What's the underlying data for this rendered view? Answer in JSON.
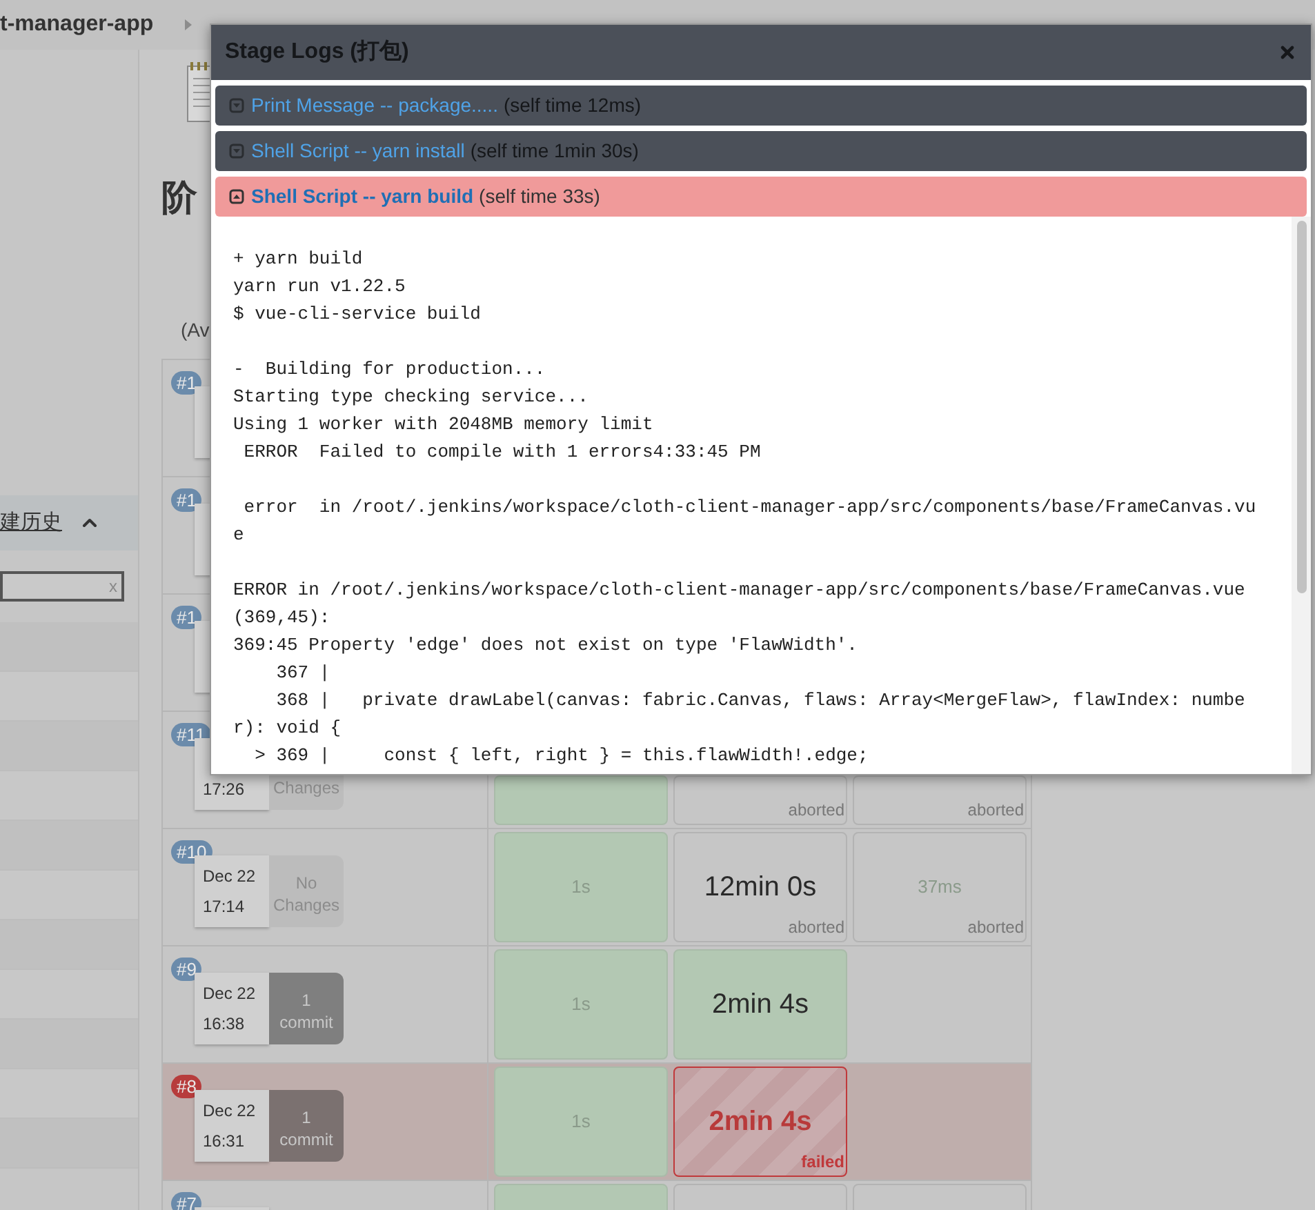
{
  "header": {
    "title": "t-manager-app"
  },
  "sidebar": {
    "section_title": "建历史",
    "expanded": true,
    "search": {
      "clear": "x"
    }
  },
  "page": {
    "heading": "阶",
    "column_hint": "(Av"
  },
  "builds": [
    {
      "number": "#1",
      "failed": false
    },
    {
      "number": "#1",
      "failed": false
    },
    {
      "number": "#1",
      "failed": false
    },
    {
      "number": "#11",
      "failed": false,
      "time": "17:26",
      "changes": {
        "text": "Changes",
        "has_changes": false
      },
      "stages": [
        {
          "kind": "success"
        },
        {
          "kind": "aborted",
          "label": "aborted"
        },
        {
          "kind": "aborted",
          "label": "aborted"
        }
      ]
    },
    {
      "number": "#10",
      "failed": false,
      "date": "Dec 22",
      "time": "17:14",
      "changes": {
        "text": "No Changes",
        "has_changes": false
      },
      "stages": [
        {
          "kind": "success",
          "duration": "1s",
          "emphasized": false
        },
        {
          "kind": "aborted",
          "duration": "12min 0s",
          "emphasized": true,
          "label": "aborted"
        },
        {
          "kind": "aborted",
          "duration": "37ms",
          "emphasized": false,
          "label": "aborted"
        }
      ]
    },
    {
      "number": "#9",
      "failed": false,
      "date": "Dec 22",
      "time": "16:38",
      "changes": {
        "text": "1 commit",
        "has_changes": true
      },
      "stages": [
        {
          "kind": "success",
          "duration": "1s",
          "emphasized": false
        },
        {
          "kind": "success",
          "duration": "2min 4s",
          "emphasized": true
        },
        {
          "kind": "empty"
        }
      ]
    },
    {
      "number": "#8",
      "failed": true,
      "date": "Dec 22",
      "time": "16:31",
      "changes": {
        "text": "1 commit",
        "has_changes": true
      },
      "stages": [
        {
          "kind": "success",
          "duration": "1s",
          "emphasized": false
        },
        {
          "kind": "failed",
          "duration": "2min 4s",
          "emphasized": true,
          "label": "failed"
        },
        {
          "kind": "empty"
        }
      ]
    },
    {
      "number": "#7",
      "failed": false,
      "stages": [
        {
          "kind": "success"
        },
        {
          "kind": "aborted"
        },
        {
          "kind": "aborted"
        }
      ]
    }
  ],
  "dialog": {
    "title": "Stage Logs (打包)",
    "steps": [
      {
        "name": "Print Message -- package.....",
        "self_time": "(self time 12ms)",
        "expanded": false
      },
      {
        "name": "Shell Script -- yarn install",
        "self_time": "(self time 1min 30s)",
        "expanded": false
      },
      {
        "name": "Shell Script -- yarn build",
        "self_time": "(self time 33s)",
        "expanded": true
      }
    ],
    "log": "+ yarn build\nyarn run v1.22.5\n$ vue-cli-service build\n\n-  Building for production...\nStarting type checking service...\nUsing 1 worker with 2048MB memory limit\n ERROR  Failed to compile with 1 errors4:33:45 PM\n\n error  in /root/.jenkins/workspace/cloth-client-manager-app/src/components/base/FrameCanvas.vu\ne\n\nERROR in /root/.jenkins/workspace/cloth-client-manager-app/src/components/base/FrameCanvas.vue\n(369,45):\n369:45 Property 'edge' does not exist on type 'FlawWidth'.\n    367 |\n    368 |   private drawLabel(canvas: fabric.Canvas, flaws: Array<MergeFlaw>, flawIndex: numbe\nr): void {\n  > 369 |     const { left, right } = this.flawWidth!.edge;"
  }
}
